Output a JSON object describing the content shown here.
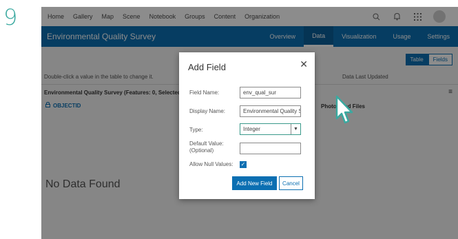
{
  "step": {
    "number": "9"
  },
  "topnav": {
    "items": [
      "Home",
      "Gallery",
      "Map",
      "Scene",
      "Notebook",
      "Groups",
      "Content",
      "Organization"
    ],
    "icons": [
      "search-icon",
      "bell-icon",
      "apps-grid-icon",
      "avatar"
    ]
  },
  "titlebar": {
    "title": "Environmental Quality Survey",
    "tabs": [
      "Overview",
      "Data",
      "Visualization",
      "Usage",
      "Settings"
    ],
    "active_tab": "Data"
  },
  "content": {
    "toggle": [
      "Table",
      "Fields"
    ],
    "toggle_selected": "Table",
    "hint": "Double-click a value in the table to change it.",
    "last_updated": "Data Last Updated",
    "table_header": "Environmental Quality Survey (Features: 0, Selected:",
    "col_objectid": "OBJECTID",
    "col_photos": "Photos and Files",
    "no_data": "No Data Found"
  },
  "dialog": {
    "title": "Add Field",
    "close_symbol": "✕",
    "field_name_label": "Field Name:",
    "field_name_value": "env_qual_sur",
    "display_name_label": "Display Name:",
    "display_name_value": "Environmental Quality Su",
    "type_label": "Type:",
    "type_value": "Integer",
    "default_label_1": "Default Value:",
    "default_label_2": "(Optional)",
    "default_value": "",
    "allow_null_label": "Allow Null Values:",
    "allow_null_checked": true,
    "add_button": "Add New Field",
    "cancel_button": "Cancel"
  },
  "colors": {
    "accent": "#0b6fb2",
    "step_number": "#3aa9a0",
    "cursor_outline": "#3aa9a0"
  }
}
